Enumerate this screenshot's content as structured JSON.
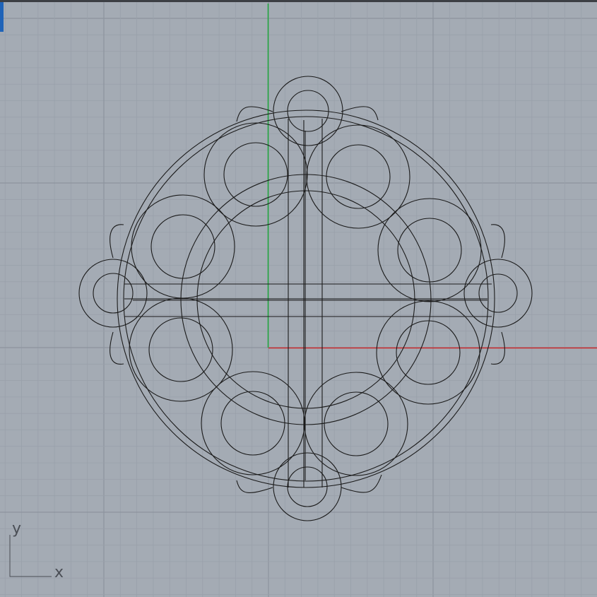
{
  "viewport": {
    "colors": {
      "background": "#a4abb4",
      "grid_minor": "#99a0aa",
      "grid_major": "#8d949e",
      "top_border": "#3c3f44",
      "active_marker": "#1f63b8",
      "x_axis": "#c8282a",
      "y_axis": "#1fa83c",
      "geometry": "#1b1b1b",
      "axis_icon": "#4a4e55"
    },
    "axis_icon": {
      "x_label": "x",
      "y_label": "y"
    }
  }
}
